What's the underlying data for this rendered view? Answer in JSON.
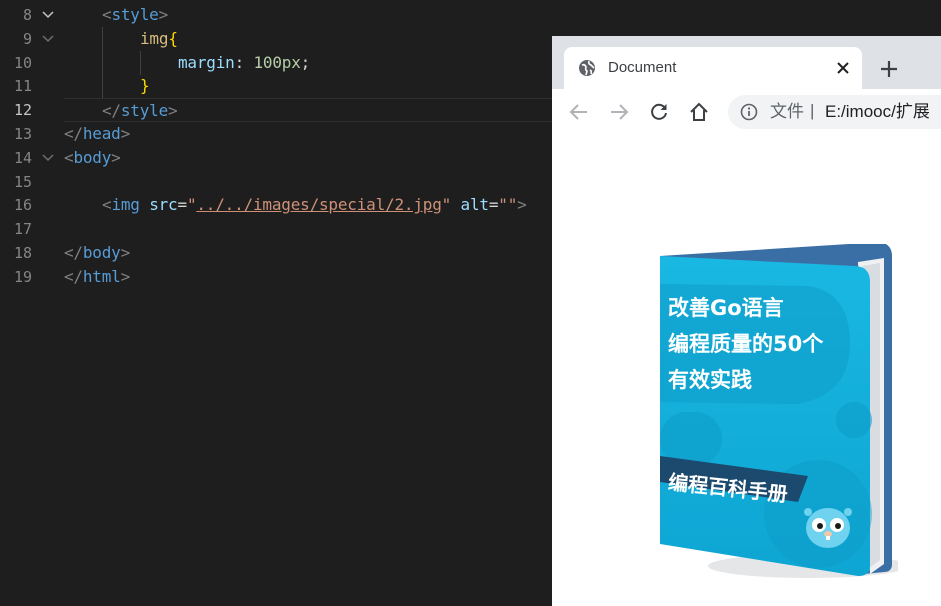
{
  "editor": {
    "lines": [
      {
        "num": "8",
        "fold": "open",
        "tokens": [
          [
            "punct",
            "<"
          ],
          [
            "tag",
            "style"
          ],
          [
            "punct",
            ">"
          ]
        ],
        "indent": 1
      },
      {
        "num": "9",
        "fold": "open",
        "tokens": [
          [
            "sel",
            "img"
          ],
          [
            "brace",
            "{"
          ]
        ],
        "indent": 2
      },
      {
        "num": "10",
        "fold": "",
        "tokens": [
          [
            "prop",
            "margin"
          ],
          [
            "plain",
            ": "
          ],
          [
            "num",
            "100px"
          ],
          [
            "plain",
            ";"
          ]
        ],
        "indent": 3
      },
      {
        "num": "11",
        "fold": "",
        "tokens": [
          [
            "brace",
            "}"
          ]
        ],
        "indent": 2
      },
      {
        "num": "12",
        "fold": "",
        "tokens": [
          [
            "punct",
            "</"
          ],
          [
            "tag",
            "style"
          ],
          [
            "punct",
            ">"
          ]
        ],
        "indent": 1,
        "active": true
      },
      {
        "num": "13",
        "fold": "",
        "tokens": [
          [
            "punct",
            "</"
          ],
          [
            "tag",
            "head"
          ],
          [
            "punct",
            ">"
          ]
        ],
        "indent": 0
      },
      {
        "num": "14",
        "fold": "open",
        "tokens": [
          [
            "punct",
            "<"
          ],
          [
            "tag",
            "body"
          ],
          [
            "punct",
            ">"
          ]
        ],
        "indent": 0
      },
      {
        "num": "15",
        "fold": "",
        "tokens": [],
        "indent": 0
      },
      {
        "num": "16",
        "fold": "",
        "tokens": [
          [
            "punct",
            "<"
          ],
          [
            "tag",
            "img"
          ],
          [
            "plain",
            " "
          ],
          [
            "attr",
            "src"
          ],
          [
            "plain",
            "="
          ],
          [
            "str",
            "\""
          ],
          [
            "link",
            "../../images/special/2.jpg"
          ],
          [
            "str",
            "\""
          ],
          [
            "plain",
            " "
          ],
          [
            "attr",
            "alt"
          ],
          [
            "plain",
            "="
          ],
          [
            "str",
            "\"\""
          ],
          [
            "punct",
            ">"
          ]
        ],
        "indent": 1
      },
      {
        "num": "17",
        "fold": "",
        "tokens": [],
        "indent": 0
      },
      {
        "num": "18",
        "fold": "",
        "tokens": [
          [
            "punct",
            "</"
          ],
          [
            "tag",
            "body"
          ],
          [
            "punct",
            ">"
          ]
        ],
        "indent": 0
      },
      {
        "num": "19",
        "fold": "",
        "tokens": [
          [
            "punct",
            "</"
          ],
          [
            "tag",
            "html"
          ],
          [
            "punct",
            ">"
          ]
        ],
        "indent": 0
      }
    ]
  },
  "browser": {
    "tab_title": "Document",
    "url_scheme": "文件",
    "url_separator": "|",
    "url": "E:/imooc/扩展",
    "icons": {
      "tab": "globe-icon",
      "close": "close-icon",
      "new_tab": "plus-icon",
      "back": "back-arrow-icon",
      "forward": "forward-arrow-icon",
      "reload": "reload-icon",
      "home": "home-icon",
      "info": "info-icon"
    }
  },
  "book": {
    "title_lines": [
      "改善Go语言",
      "编程质量的50个",
      "有效实践"
    ],
    "banner": "编程百科手册"
  },
  "colors": {
    "editor_bg": "#1e1e1e",
    "book_cyan": "#16b3dc",
    "book_spine": "#3a6fa6"
  }
}
